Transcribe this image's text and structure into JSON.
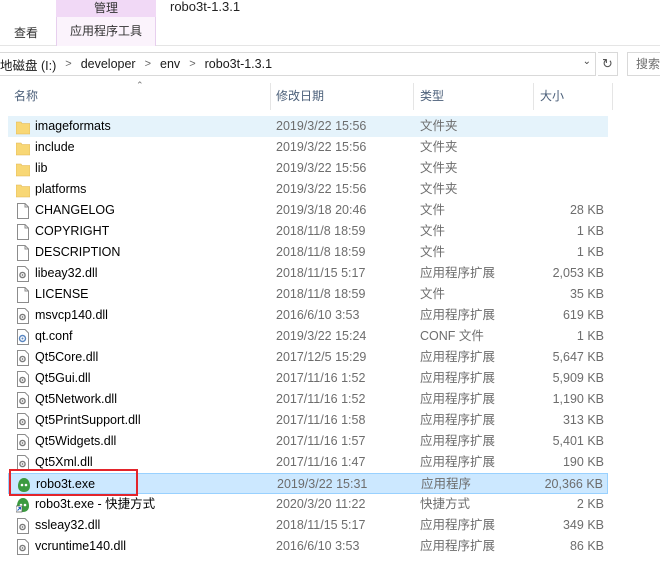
{
  "ribbon": {
    "context_group": "管理",
    "context_tab": "应用程序工具",
    "view_tab": "查看",
    "window_title": "robo3t-1.3.1"
  },
  "address": {
    "crumbs": [
      "地磁盘 (I:)",
      "developer",
      "env",
      "robo3t-1.3.1"
    ],
    "search_placeholder": "搜索"
  },
  "columns": {
    "name": "名称",
    "date": "修改日期",
    "type": "类型",
    "size": "大小"
  },
  "files": [
    {
      "name": "imageformats",
      "date": "2019/3/22 15:56",
      "type": "文件夹",
      "size": "",
      "icon": "folder-icon",
      "state": "hover"
    },
    {
      "name": "include",
      "date": "2019/3/22 15:56",
      "type": "文件夹",
      "size": "",
      "icon": "folder-icon",
      "state": ""
    },
    {
      "name": "lib",
      "date": "2019/3/22 15:56",
      "type": "文件夹",
      "size": "",
      "icon": "folder-icon",
      "state": ""
    },
    {
      "name": "platforms",
      "date": "2019/3/22 15:56",
      "type": "文件夹",
      "size": "",
      "icon": "folder-icon",
      "state": ""
    },
    {
      "name": "CHANGELOG",
      "date": "2019/3/18 20:46",
      "type": "文件",
      "size": "28 KB",
      "icon": "file-icon",
      "state": ""
    },
    {
      "name": "COPYRIGHT",
      "date": "2018/11/8 18:59",
      "type": "文件",
      "size": "1 KB",
      "icon": "file-icon",
      "state": ""
    },
    {
      "name": "DESCRIPTION",
      "date": "2018/11/8 18:59",
      "type": "文件",
      "size": "1 KB",
      "icon": "file-icon",
      "state": ""
    },
    {
      "name": "libeay32.dll",
      "date": "2018/11/15 5:17",
      "type": "应用程序扩展",
      "size": "2,053 KB",
      "icon": "dll-icon",
      "state": ""
    },
    {
      "name": "LICENSE",
      "date": "2018/11/8 18:59",
      "type": "文件",
      "size": "35 KB",
      "icon": "file-icon",
      "state": ""
    },
    {
      "name": "msvcp140.dll",
      "date": "2016/6/10 3:53",
      "type": "应用程序扩展",
      "size": "619 KB",
      "icon": "dll-icon",
      "state": ""
    },
    {
      "name": "qt.conf",
      "date": "2019/3/22 15:24",
      "type": "CONF 文件",
      "size": "1 KB",
      "icon": "conf-icon",
      "state": ""
    },
    {
      "name": "Qt5Core.dll",
      "date": "2017/12/5 15:29",
      "type": "应用程序扩展",
      "size": "5,647 KB",
      "icon": "dll-icon",
      "state": ""
    },
    {
      "name": "Qt5Gui.dll",
      "date": "2017/11/16 1:52",
      "type": "应用程序扩展",
      "size": "5,909 KB",
      "icon": "dll-icon",
      "state": ""
    },
    {
      "name": "Qt5Network.dll",
      "date": "2017/11/16 1:52",
      "type": "应用程序扩展",
      "size": "1,190 KB",
      "icon": "dll-icon",
      "state": ""
    },
    {
      "name": "Qt5PrintSupport.dll",
      "date": "2017/11/16 1:58",
      "type": "应用程序扩展",
      "size": "313 KB",
      "icon": "dll-icon",
      "state": ""
    },
    {
      "name": "Qt5Widgets.dll",
      "date": "2017/11/16 1:57",
      "type": "应用程序扩展",
      "size": "5,401 KB",
      "icon": "dll-icon",
      "state": ""
    },
    {
      "name": "Qt5Xml.dll",
      "date": "2017/11/16 1:47",
      "type": "应用程序扩展",
      "size": "190 KB",
      "icon": "dll-icon",
      "state": ""
    },
    {
      "name": "robo3t.exe",
      "date": "2019/3/22 15:31",
      "type": "应用程序",
      "size": "20,366 KB",
      "icon": "robo3t-app-icon",
      "state": "selected"
    },
    {
      "name": "robo3t.exe - 快捷方式",
      "date": "2020/3/20 11:22",
      "type": "快捷方式",
      "size": "2 KB",
      "icon": "robo3t-shortcut-icon",
      "state": ""
    },
    {
      "name": "ssleay32.dll",
      "date": "2018/11/15 5:17",
      "type": "应用程序扩展",
      "size": "349 KB",
      "icon": "dll-icon",
      "state": ""
    },
    {
      "name": "vcruntime140.dll",
      "date": "2016/6/10 3:53",
      "type": "应用程序扩展",
      "size": "86 KB",
      "icon": "dll-icon",
      "state": ""
    }
  ],
  "colors": {
    "hover_row": "#e5f3fb",
    "selected_row": "#cce8ff",
    "folder": "#f8d775",
    "robo3t_green": "#3b9a3f",
    "highlight_box": "#e3242b"
  }
}
